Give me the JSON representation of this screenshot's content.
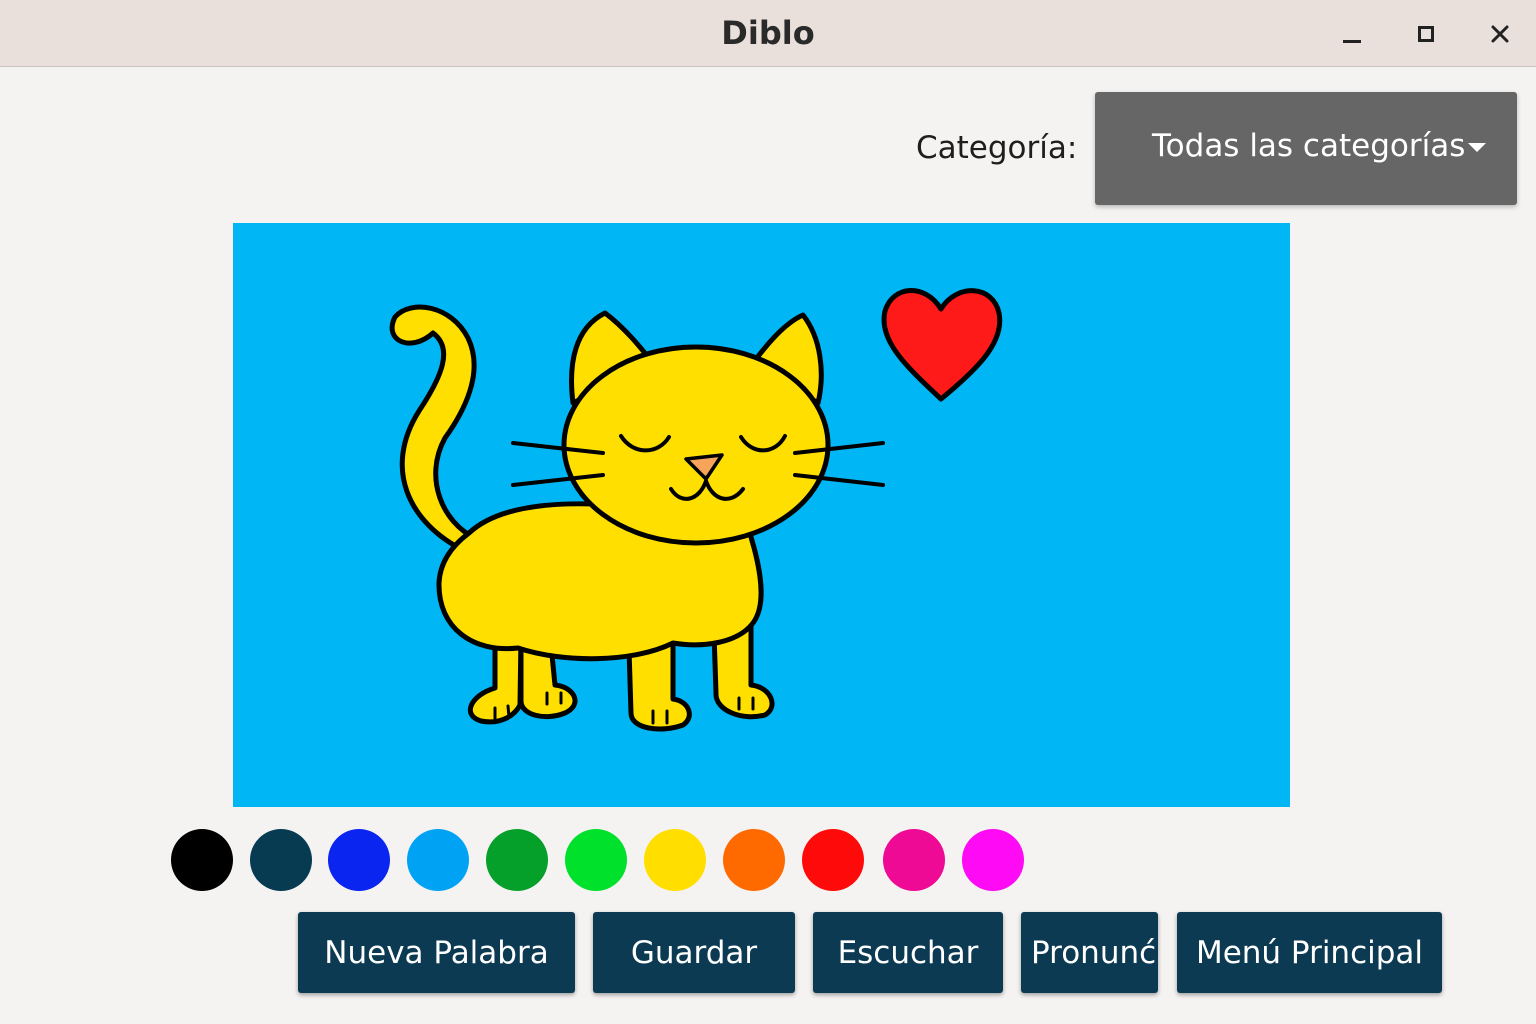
{
  "window": {
    "title": "Diblo",
    "controls": [
      "minimize",
      "maximize",
      "close"
    ]
  },
  "category": {
    "label": "Categoría:",
    "selected": "Todas las categorías"
  },
  "drawing": {
    "background": "#00b6f5",
    "subject": "gato",
    "colors": {
      "cat_fill": "#ffdf00",
      "heart_fill": "#ff1a1a",
      "nose_fill": "#f5a45a",
      "outline": "#000000"
    }
  },
  "palette": [
    {
      "name": "black",
      "hex": "#000000"
    },
    {
      "name": "dark-navy",
      "hex": "#073b52"
    },
    {
      "name": "blue",
      "hex": "#0a25f0"
    },
    {
      "name": "light-blue",
      "hex": "#00a2f4"
    },
    {
      "name": "dark-green",
      "hex": "#05a02a"
    },
    {
      "name": "green",
      "hex": "#00e12c"
    },
    {
      "name": "yellow",
      "hex": "#ffde00"
    },
    {
      "name": "orange",
      "hex": "#ff6a00"
    },
    {
      "name": "red",
      "hex": "#ff0a0a"
    },
    {
      "name": "pink",
      "hex": "#ee0a94"
    },
    {
      "name": "magenta",
      "hex": "#fe0af5"
    }
  ],
  "buttons": {
    "nueva_palabra": "Nueva Palabra",
    "guardar": "Guardar",
    "escuchar": "Escuchar",
    "pronunciar": "Pronunć",
    "menu_principal": "Menú Principal"
  },
  "theme": {
    "titlebar_bg": "#e9e0dc",
    "window_bg": "#f4f3f2",
    "dropdown_bg": "#666666",
    "button_bg": "#0b3a52"
  }
}
